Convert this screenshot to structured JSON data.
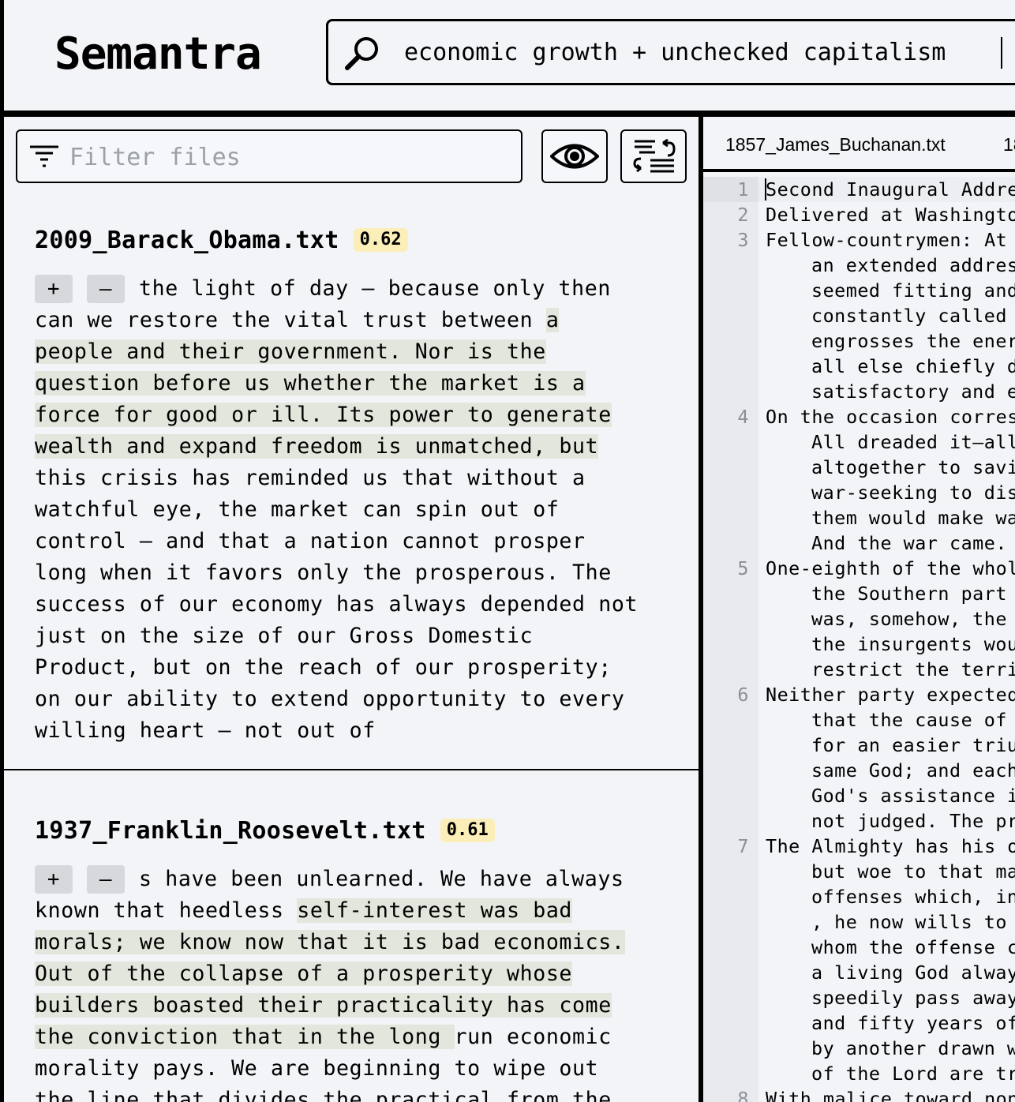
{
  "app": {
    "name": "Semantra"
  },
  "search": {
    "query": "economic growth + unchecked capitalism"
  },
  "filter": {
    "placeholder": "Filter files"
  },
  "toolbar": {
    "preview_icon": "eye-icon",
    "sort_icon": "sort-icon"
  },
  "results": [
    {
      "filename": "2009_Barack_Obama.txt",
      "score": "0.62",
      "plus_label": "+",
      "minus_label": "–",
      "lines": [
        [
          {
            "t": "the light of day — because only then",
            "h": false
          }
        ],
        [
          {
            "t": "can we restore the vital trust between ",
            "h": false
          },
          {
            "t": "a",
            "h": true
          }
        ],
        [
          {
            "t": "people and their government. Nor is the",
            "h": true
          }
        ],
        [
          {
            "t": "question before us whether the market is a",
            "h": true
          }
        ],
        [
          {
            "t": "force for good or ill. Its power to generate",
            "h": true
          }
        ],
        [
          {
            "t": "wealth and expand freedom is unmatched, but",
            "h": true
          }
        ],
        [
          {
            "t": "this crisis has reminded us that without a",
            "h": false
          }
        ],
        [
          {
            "t": "watchful eye, the market can spin out of",
            "h": false
          }
        ],
        [
          {
            "t": "control — and that a nation cannot prosper",
            "h": false
          }
        ],
        [
          {
            "t": "long when it favors only the prosperous. The",
            "h": false
          }
        ],
        [
          {
            "t": "success of our economy has always depended not",
            "h": false
          }
        ],
        [
          {
            "t": "just on the size of our Gross Domestic",
            "h": false
          }
        ],
        [
          {
            "t": "Product, but on the reach of our prosperity;",
            "h": false
          }
        ],
        [
          {
            "t": "on our ability to extend opportunity to every",
            "h": false
          }
        ],
        [
          {
            "t": "willing heart — not out of",
            "h": false
          }
        ]
      ]
    },
    {
      "filename": "1937_Franklin_Roosevelt.txt",
      "score": "0.61",
      "plus_label": "+",
      "minus_label": "–",
      "lines": [
        [
          {
            "t": "s have been unlearned. We have always",
            "h": false
          }
        ],
        [
          {
            "t": "known that heedless ",
            "h": false
          },
          {
            "t": "self-interest was bad",
            "h": true
          }
        ],
        [
          {
            "t": "morals; we know now that it is bad economics.",
            "h": true
          }
        ],
        [
          {
            "t": "Out of the collapse of a prosperity whose",
            "h": true
          }
        ],
        [
          {
            "t": "builders boasted their practicality has come",
            "h": true
          }
        ],
        [
          {
            "t": "the conviction that in the long ",
            "h": true
          },
          {
            "t": "run economic",
            "h": false
          }
        ],
        [
          {
            "t": "morality pays. We are beginning to wipe out",
            "h": false
          }
        ],
        [
          {
            "t": "the line that divides the practical from the",
            "h": false
          }
        ]
      ]
    }
  ],
  "preview": {
    "tabs": [
      "1857_James_Buchanan.txt",
      "18"
    ],
    "lines": [
      {
        "n": "1",
        "t": "Second Inaugural Addre"
      },
      {
        "n": "2",
        "t": "Delivered at Washingto"
      },
      {
        "n": "3",
        "t": "Fellow-countrymen: At"
      },
      {
        "n": "",
        "t": "an extended addres"
      },
      {
        "n": "",
        "t": "seemed fitting and"
      },
      {
        "n": "",
        "t": "constantly called"
      },
      {
        "n": "",
        "t": "engrosses the ener"
      },
      {
        "n": "",
        "t": "all else chiefly d"
      },
      {
        "n": "",
        "t": "satisfactory and e"
      },
      {
        "n": "4",
        "t": "On the occasion corres"
      },
      {
        "n": "",
        "t": "All dreaded it—all"
      },
      {
        "n": "",
        "t": "altogether to savi"
      },
      {
        "n": "",
        "t": "war-seeking to dis"
      },
      {
        "n": "",
        "t": "them would make wa"
      },
      {
        "n": "",
        "t": "And the war came."
      },
      {
        "n": "5",
        "t": "One-eighth of the whol"
      },
      {
        "n": "",
        "t": "the Southern part"
      },
      {
        "n": "",
        "t": "was, somehow, the"
      },
      {
        "n": "",
        "t": "the insurgents wou"
      },
      {
        "n": "",
        "t": "restrict the terri"
      },
      {
        "n": "6",
        "t": "Neither party expected"
      },
      {
        "n": "",
        "t": "that the cause of"
      },
      {
        "n": "",
        "t": "for an easier triu"
      },
      {
        "n": "",
        "t": "same God; and each"
      },
      {
        "n": "",
        "t": "God's assistance i"
      },
      {
        "n": "",
        "t": "not judged. The pr"
      },
      {
        "n": "7",
        "t": "The Almighty has his o"
      },
      {
        "n": "",
        "t": "but woe to that ma"
      },
      {
        "n": "",
        "t": "offenses which, in"
      },
      {
        "n": "",
        "t": ", he now wills to"
      },
      {
        "n": "",
        "t": "whom the offense c"
      },
      {
        "n": "",
        "t": "a living God alway"
      },
      {
        "n": "",
        "t": "speedily pass away"
      },
      {
        "n": "",
        "t": "and fifty years of"
      },
      {
        "n": "",
        "t": "by another drawn w"
      },
      {
        "n": "",
        "t": "of the Lord are tr"
      },
      {
        "n": "8",
        "t": "With malice toward non"
      }
    ]
  }
}
